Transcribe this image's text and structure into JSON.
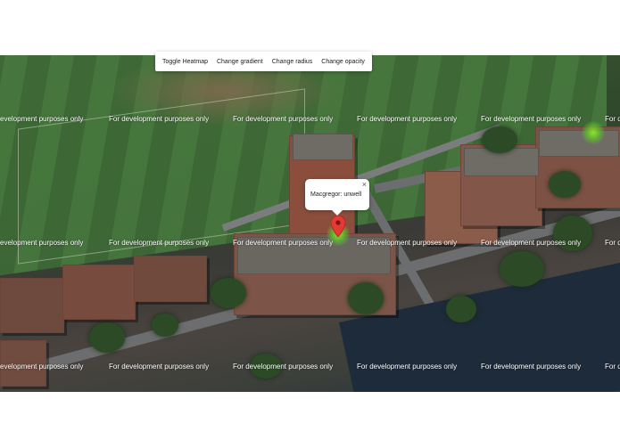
{
  "controls": {
    "toggle_heatmap": "Toggle Heatmap",
    "change_gradient": "Change gradient",
    "change_radius": "Change radius",
    "change_opacity": "Change opacity"
  },
  "infowindow": {
    "text": "Macgregor: unwell",
    "close_glyph": "×"
  },
  "map": {
    "watermark_text": "For development purposes only",
    "watermark_left_cut": "evelopment purposes only",
    "watermark_right_cut": "For d"
  },
  "colors": {
    "heatmap_point": "#8fdc2e",
    "marker": "#e53935"
  },
  "icons": {
    "marker": "map-pin-icon",
    "close": "close-icon"
  }
}
